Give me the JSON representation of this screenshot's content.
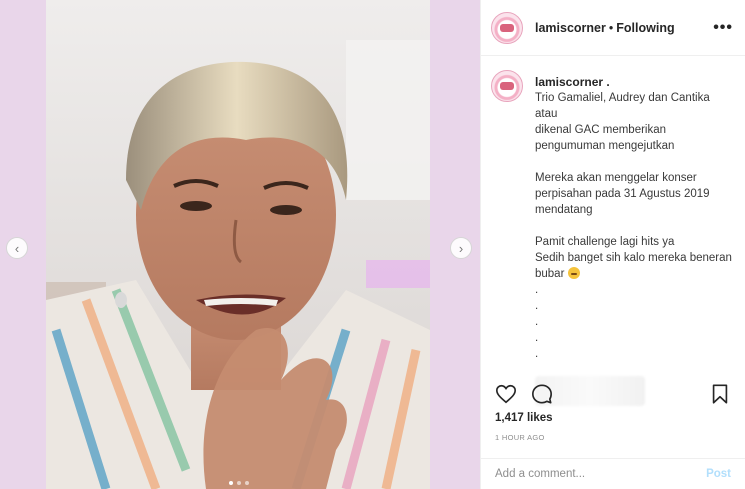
{
  "post": {
    "username": "lamiscorner",
    "separator": "•",
    "follow_status": "Following",
    "more_label": "•••"
  },
  "caption": {
    "username": "lamiscorner .",
    "paragraph1": [
      "Trio Gamaliel, Audrey dan Cantika atau",
      "dikenal GAC memberikan",
      "pengumuman mengejutkan"
    ],
    "paragraph2": [
      "Mereka akan menggelar konser",
      "perpisahan pada 31 Agustus 2019",
      "mendatang"
    ],
    "paragraph3": [
      "Pamit challenge lagi hits ya",
      "Sedih banget sih kalo mereka beneran",
      "bubar"
    ],
    "dots": [
      ".",
      ".",
      ".",
      ".",
      "."
    ],
    "emoji": "sad-face-emoji"
  },
  "media": {
    "prev_arrow": "‹",
    "next_arrow": "›",
    "carousel_count": 3,
    "carousel_active": 1
  },
  "engagement": {
    "likes": "1,417 likes",
    "timestamp": "1 HOUR AGO"
  },
  "comment": {
    "placeholder": "Add a comment...",
    "post_label": "Post"
  },
  "icons": {
    "like": "heart-icon",
    "comment": "comment-icon",
    "share": "share-icon",
    "save": "bookmark-icon"
  },
  "colors": {
    "background_left": "#e9d6ea",
    "text": "#262626",
    "muted": "#8e8e8e",
    "post_disabled": "#b2dffc"
  }
}
